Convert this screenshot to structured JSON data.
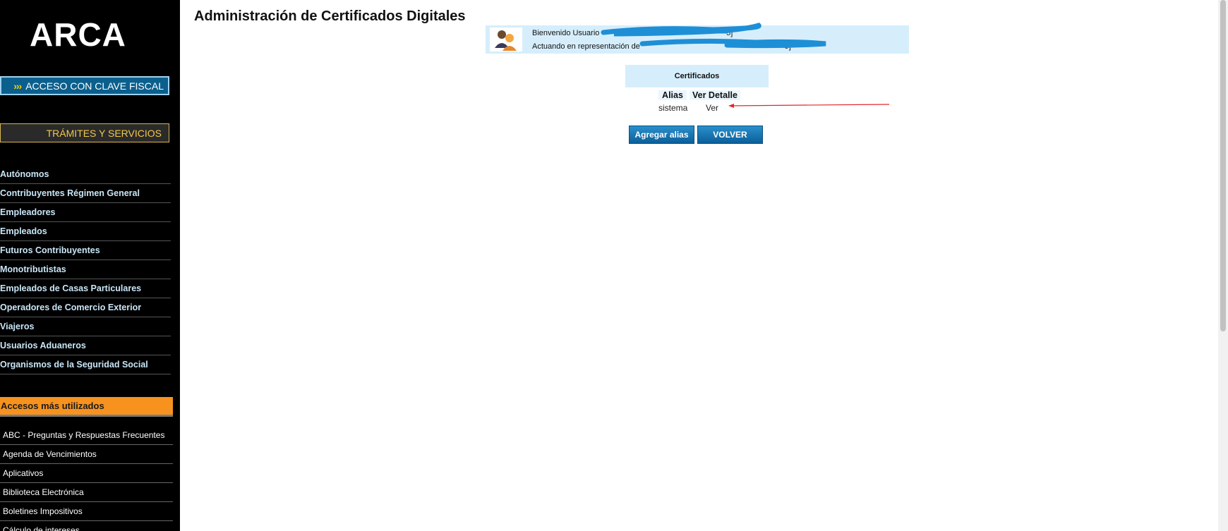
{
  "sidebar": {
    "logo": "ARCA",
    "clave_fiscal_button": "ACCESO CON CLAVE FISCAL",
    "tramites_button": "TRÁMITES Y SERVICIOS",
    "nav_items": [
      "Autónomos",
      "Contribuyentes Régimen General",
      "Empleadores",
      "Empleados",
      "Futuros Contribuyentes",
      "Monotributistas",
      "Empleados de Casas Particulares",
      "Operadores de Comercio Exterior",
      "Viajeros",
      "Usuarios Aduaneros",
      "Organismos de la Seguridad Social"
    ],
    "accesos_title": "Accesos más utilizados",
    "accesos_items": [
      "ABC - Preguntas y Respuestas Frecuentes",
      "Agenda de Vencimientos",
      "Aplicativos",
      "Biblioteca Electrónica",
      "Boletines Impositivos",
      "Cálculo de intereses"
    ]
  },
  "main": {
    "title": "Administración de Certificados Digitales",
    "user_panel": {
      "welcome_prefix": "Bienvenido Usuario",
      "welcome_tail": "[",
      "acting_prefix": "Actuando en representación de",
      "acting_tail": "[",
      "welcome_end": "-5]",
      "acting_end": "-9]"
    },
    "certificates": {
      "heading": "Certificados",
      "col_alias": "Alias",
      "col_detail": "Ver Detalle",
      "rows": [
        {
          "alias": "sistema",
          "action": "Ver"
        }
      ]
    },
    "buttons": {
      "add_alias": "Agregar alias",
      "back": "VOLVER"
    }
  },
  "colors": {
    "sidebar_bg": "#000000",
    "nav_text": "#c9e6f7",
    "accent_orange": "#f7921e",
    "panel_blue": "#d6eefc",
    "button_blue": "#0b5f99",
    "scribble_blue": "#1e8fd6",
    "annotation_red": "#e0282a"
  }
}
